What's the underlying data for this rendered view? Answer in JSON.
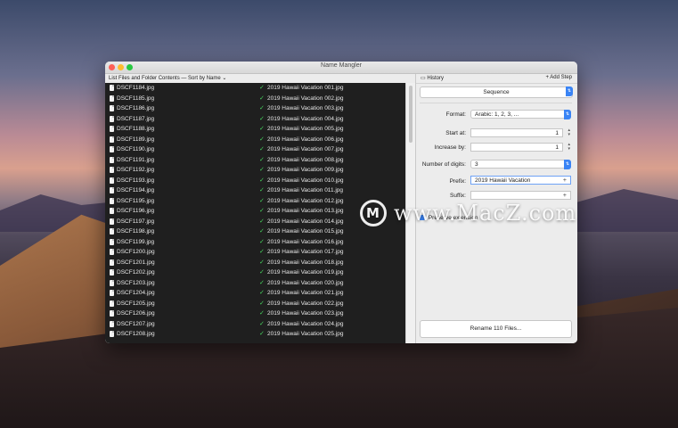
{
  "window": {
    "title": "Name Mangler"
  },
  "left_panel": {
    "header": "List Files and Folder Contents — Sort by Name ⌄",
    "rows": [
      {
        "old": "DSCF1184.jpg",
        "new": "2019 Hawaii Vacation 001.jpg"
      },
      {
        "old": "DSCF1185.jpg",
        "new": "2019 Hawaii Vacation 002.jpg"
      },
      {
        "old": "DSCF1186.jpg",
        "new": "2019 Hawaii Vacation 003.jpg"
      },
      {
        "old": "DSCF1187.jpg",
        "new": "2019 Hawaii Vacation 004.jpg"
      },
      {
        "old": "DSCF1188.jpg",
        "new": "2019 Hawaii Vacation 005.jpg"
      },
      {
        "old": "DSCF1189.jpg",
        "new": "2019 Hawaii Vacation 006.jpg"
      },
      {
        "old": "DSCF1190.jpg",
        "new": "2019 Hawaii Vacation 007.jpg"
      },
      {
        "old": "DSCF1191.jpg",
        "new": "2019 Hawaii Vacation 008.jpg"
      },
      {
        "old": "DSCF1192.jpg",
        "new": "2019 Hawaii Vacation 009.jpg"
      },
      {
        "old": "DSCF1193.jpg",
        "new": "2019 Hawaii Vacation 010.jpg"
      },
      {
        "old": "DSCF1194.jpg",
        "new": "2019 Hawaii Vacation 011.jpg"
      },
      {
        "old": "DSCF1195.jpg",
        "new": "2019 Hawaii Vacation 012.jpg"
      },
      {
        "old": "DSCF1196.jpg",
        "new": "2019 Hawaii Vacation 013.jpg"
      },
      {
        "old": "DSCF1197.jpg",
        "new": "2019 Hawaii Vacation 014.jpg"
      },
      {
        "old": "DSCF1198.jpg",
        "new": "2019 Hawaii Vacation 015.jpg"
      },
      {
        "old": "DSCF1199.jpg",
        "new": "2019 Hawaii Vacation 016.jpg"
      },
      {
        "old": "DSCF1200.jpg",
        "new": "2019 Hawaii Vacation 017.jpg"
      },
      {
        "old": "DSCF1201.jpg",
        "new": "2019 Hawaii Vacation 018.jpg"
      },
      {
        "old": "DSCF1202.jpg",
        "new": "2019 Hawaii Vacation 019.jpg"
      },
      {
        "old": "DSCF1203.jpg",
        "new": "2019 Hawaii Vacation 020.jpg"
      },
      {
        "old": "DSCF1204.jpg",
        "new": "2019 Hawaii Vacation 021.jpg"
      },
      {
        "old": "DSCF1205.jpg",
        "new": "2019 Hawaii Vacation 022.jpg"
      },
      {
        "old": "DSCF1206.jpg",
        "new": "2019 Hawaii Vacation 023.jpg"
      },
      {
        "old": "DSCF1207.jpg",
        "new": "2019 Hawaii Vacation 024.jpg"
      },
      {
        "old": "DSCF1208.jpg",
        "new": "2019 Hawaii Vacation 025.jpg"
      }
    ]
  },
  "right_panel": {
    "history_label": "History",
    "add_step_label": "+ Add Step",
    "step_select": "Sequence",
    "format_label": "Format:",
    "format_value": "Arabic: 1, 2, 3, ...",
    "start_label": "Start at:",
    "start_value": "1",
    "increase_label": "Increase by:",
    "increase_value": "1",
    "digits_label": "Number of digits:",
    "digits_value": "3",
    "prefix_label": "Prefix:",
    "prefix_value": "2019 Hawaii Vacation",
    "suffix_label": "Suffix:",
    "suffix_value": "",
    "preserve_label": "Preserve extension",
    "rename_button": "Rename 110 Files..."
  },
  "watermark": {
    "logo_letter": "M",
    "text": "www.MacZ.com"
  },
  "colors": {
    "accent": "#3a84f5",
    "check": "#46d35e",
    "list_bg": "#1f1f1f"
  }
}
